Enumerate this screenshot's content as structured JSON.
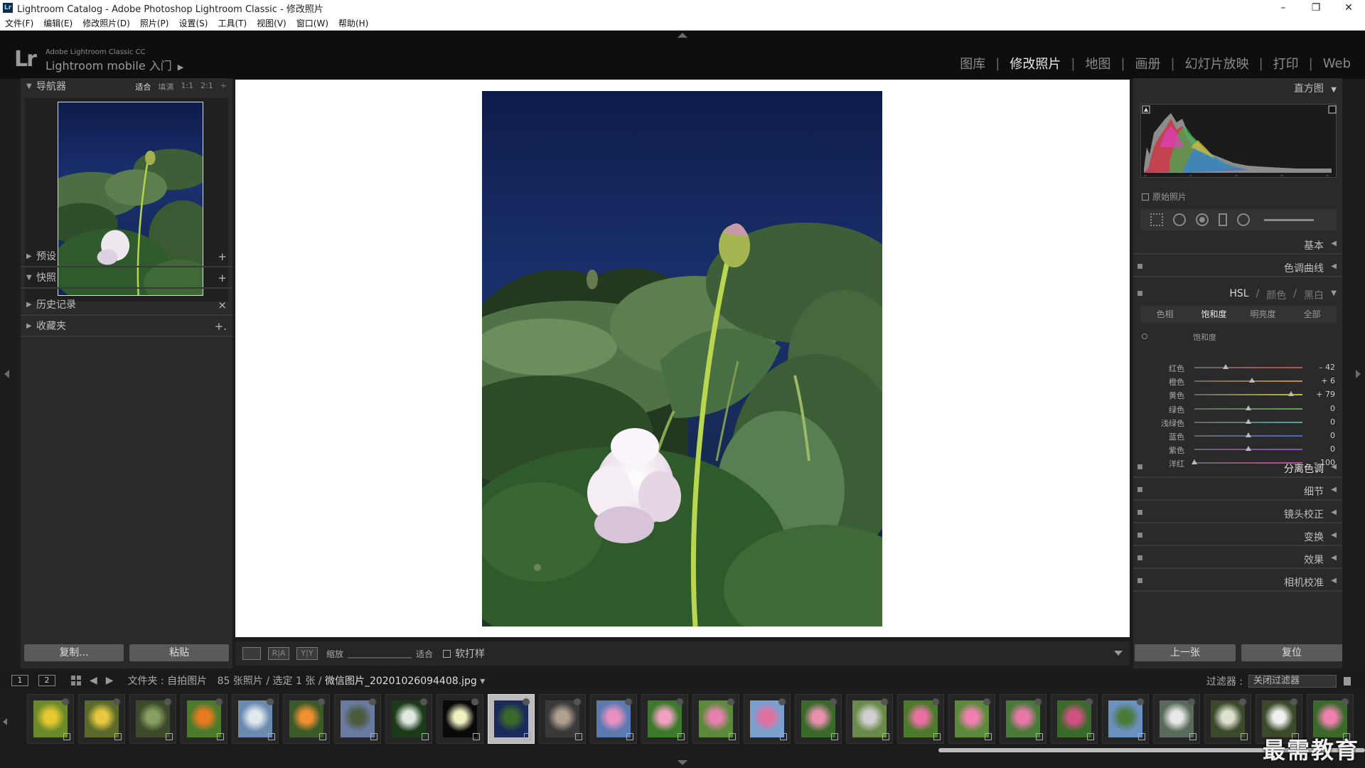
{
  "window": {
    "title": "Lightroom Catalog - Adobe Photoshop Lightroom Classic - 修改照片",
    "app_badge": "Lr",
    "minimize": "–",
    "maximize": "❐",
    "close": "✕"
  },
  "menu": [
    "文件(F)",
    "编辑(E)",
    "修改照片(D)",
    "照片(P)",
    "设置(S)",
    "工具(T)",
    "视图(V)",
    "窗口(W)",
    "帮助(H)"
  ],
  "identity": {
    "logo": "Lr",
    "small": "Adobe Lightroom Classic CC",
    "big": "Lightroom mobile 入门",
    "arrow": "▶"
  },
  "modules": [
    {
      "label": "图库",
      "active": false
    },
    {
      "label": "修改照片",
      "active": true
    },
    {
      "label": "地图",
      "active": false
    },
    {
      "label": "画册",
      "active": false
    },
    {
      "label": "幻灯片放映",
      "active": false
    },
    {
      "label": "打印",
      "active": false
    },
    {
      "label": "Web",
      "active": false
    }
  ],
  "module_separator": "|",
  "left_panel": {
    "navigator": {
      "title": "导航器",
      "modes": [
        "适合",
        "填满",
        "1:1",
        "2:1"
      ],
      "active_mode": "适合",
      "mode_spinner": "÷"
    },
    "sections": [
      {
        "label": "预设",
        "expanded": false,
        "action": "+"
      },
      {
        "label": "快照",
        "expanded": true,
        "action": "+"
      },
      {
        "label": "历史记录",
        "expanded": false,
        "action": "×"
      },
      {
        "label": "收藏夹",
        "expanded": false,
        "action": "+."
      }
    ],
    "copy_button": "复制...",
    "paste_button": "粘贴"
  },
  "toolbar": {
    "zoom_label": "缩放",
    "zoom_value": "适合",
    "before_after_label": "R|A",
    "yy_label": "Y|Y",
    "soft_proof_label": "软打样"
  },
  "right_panel": {
    "histogram_title": "直方图",
    "original_photo": "原始照片",
    "basic": "基本",
    "tone_curve": "色调曲线",
    "hsl_tabs": [
      "HSL",
      "颜色",
      "黑白"
    ],
    "hsl_tab_separator": "/",
    "hsl_active_tab": "HSL",
    "hsl_subtabs": [
      "色相",
      "饱和度",
      "明亮度",
      "全部"
    ],
    "hsl_active_subtab": "饱和度",
    "saturation_title": "饱和度",
    "saturation": [
      {
        "name": "红色",
        "value": -42,
        "display": "– 42",
        "track": "#c0504d"
      },
      {
        "name": "橙色",
        "value": 6,
        "display": "+ 6",
        "track": "#d08a40"
      },
      {
        "name": "黄色",
        "value": 79,
        "display": "+ 79",
        "track": "#c8b840"
      },
      {
        "name": "绿色",
        "value": 0,
        "display": "0",
        "track": "#5aa84a"
      },
      {
        "name": "浅绿色",
        "value": 0,
        "display": "0",
        "track": "#4aa8a0"
      },
      {
        "name": "蓝色",
        "value": 0,
        "display": "0",
        "track": "#4a6ac0"
      },
      {
        "name": "紫色",
        "value": 0,
        "display": "0",
        "track": "#8a4ac0"
      },
      {
        "name": "洋红",
        "value": -100,
        "display": "– 100",
        "track": "#c04a9a"
      }
    ],
    "sections_after": [
      "分离色调",
      "细节",
      "镜头校正",
      "变换",
      "效果",
      "相机校准"
    ],
    "prev_button": "上一张",
    "reset_button": "复位"
  },
  "filmstrip_bar": {
    "view1": "1",
    "view2": "2",
    "back_arrow": "◀",
    "forward_arrow": "▶",
    "source_prefix": "文件夹 : 自拍图片",
    "source_count": "85 张照片 / 选定 1 张 /",
    "file_name": "微信图片_20201026094408.jpg",
    "file_menu": "▾",
    "filter_label": "过滤器 :",
    "filter_value": "关闭过滤器"
  },
  "filmstrip": {
    "selected_index": 9,
    "thumbnails": [
      {
        "colors": [
          "#6b8a2a",
          "#e6c830"
        ]
      },
      {
        "colors": [
          "#5a6a2a",
          "#e8c840"
        ]
      },
      {
        "colors": [
          "#3a4a2a",
          "#8aa060"
        ]
      },
      {
        "colors": [
          "#4a7a2a",
          "#e87a20"
        ]
      },
      {
        "colors": [
          "#6a8ab0",
          "#e0e8f0"
        ]
      },
      {
        "colors": [
          "#3a5a2a",
          "#f09030"
        ]
      },
      {
        "colors": [
          "#6a7aa0",
          "#4a5a3a"
        ]
      },
      {
        "colors": [
          "#1a3a1a",
          "#e0e8e0"
        ]
      },
      {
        "colors": [
          "#0a0a0a",
          "#f0f0c0"
        ]
      },
      {
        "colors": [
          "#1a2a5a",
          "#3a6a2a"
        ]
      },
      {
        "colors": [
          "#3a3a3a",
          "#b0a090"
        ]
      },
      {
        "colors": [
          "#5a7ab0",
          "#e890c0"
        ]
      },
      {
        "colors": [
          "#3a7a2a",
          "#f0a0c0"
        ]
      },
      {
        "colors": [
          "#5a8a3a",
          "#e880b0"
        ]
      },
      {
        "colors": [
          "#7aa0d0",
          "#e070a0"
        ]
      },
      {
        "colors": [
          "#3a6a2a",
          "#e890b0"
        ]
      },
      {
        "colors": [
          "#6a8a4a",
          "#d0d0d0"
        ]
      },
      {
        "colors": [
          "#4a7a2a",
          "#e870a0"
        ]
      },
      {
        "colors": [
          "#5a8a3a",
          "#f080b0"
        ]
      },
      {
        "colors": [
          "#4a7a3a",
          "#e878a8"
        ]
      },
      {
        "colors": [
          "#3a6a2a",
          "#d05080"
        ]
      },
      {
        "colors": [
          "#6a90c0",
          "#4a7a3a"
        ]
      },
      {
        "colors": [
          "#5a6a5a",
          "#e8e8e8"
        ]
      },
      {
        "colors": [
          "#3a4a2a",
          "#e0e0d0"
        ]
      },
      {
        "colors": [
          "#3a4a2a",
          "#f0f0f0"
        ]
      },
      {
        "colors": [
          "#3a6a2a",
          "#f080b0"
        ]
      }
    ]
  },
  "watermark": "最需教育",
  "colors": {
    "panel": "#2a2a2a",
    "background": "#1c1c1c",
    "active_text": "#e8e8e8",
    "inactive_text": "#8a8a8a"
  }
}
